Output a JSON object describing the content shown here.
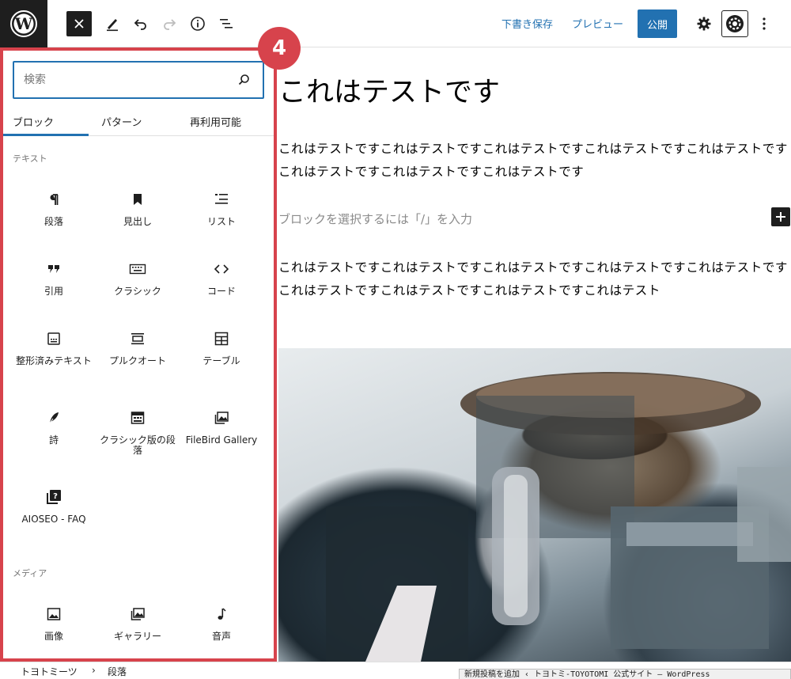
{
  "toolbar": {
    "save_draft": "下書き保存",
    "preview": "プレビュー",
    "publish": "公開"
  },
  "badge": "4",
  "inserter": {
    "search_placeholder": "検索",
    "tabs": [
      "ブロック",
      "パターン",
      "再利用可能"
    ],
    "active_tab": "ブロック",
    "categories": [
      {
        "title": "テキスト",
        "blocks": [
          {
            "label": "段落",
            "icon": "paragraph-icon"
          },
          {
            "label": "見出し",
            "icon": "bookmark-icon"
          },
          {
            "label": "リスト",
            "icon": "list-icon"
          },
          {
            "label": "引用",
            "icon": "quote-icon"
          },
          {
            "label": "クラシック",
            "icon": "keyboard-icon"
          },
          {
            "label": "コード",
            "icon": "code-icon"
          },
          {
            "label": "整形済みテキスト",
            "icon": "preformatted-icon"
          },
          {
            "label": "プルクオート",
            "icon": "pullquote-icon"
          },
          {
            "label": "テーブル",
            "icon": "table-icon"
          },
          {
            "label": "詩",
            "icon": "feather-icon"
          },
          {
            "label": "クラシック版の段落",
            "icon": "classic-paragraph-icon"
          },
          {
            "label": "FileBird Gallery",
            "icon": "gallery-icon"
          },
          {
            "label": "AIOSEO - FAQ",
            "icon": "faq-icon"
          }
        ]
      },
      {
        "title": "メディア",
        "blocks": [
          {
            "label": "画像",
            "icon": "image-icon"
          },
          {
            "label": "ギャラリー",
            "icon": "gallery-icon"
          },
          {
            "label": "音声",
            "icon": "audio-icon"
          }
        ]
      }
    ]
  },
  "editor": {
    "title": "これはテストです",
    "para1": "これはテストですこれはテストですこれはテストですこれはテストですこれはテストですこれはテストですこれはテストですこれはテストです",
    "block_placeholder": "ブロックを選択するには「/」を入力",
    "para2": "これはテストですこれはテストですこれはテストですこれはテストですこれはテストですこれはテストですこれはテストですこれはテストですこれはテスト"
  },
  "footer": {
    "breadcrumb": [
      "トヨトミーツ",
      "段落"
    ],
    "separator": "›",
    "window_title": "新規投稿を追加 ‹ トヨトミ-TOYOTOMI 公式サイト — WordPress"
  }
}
